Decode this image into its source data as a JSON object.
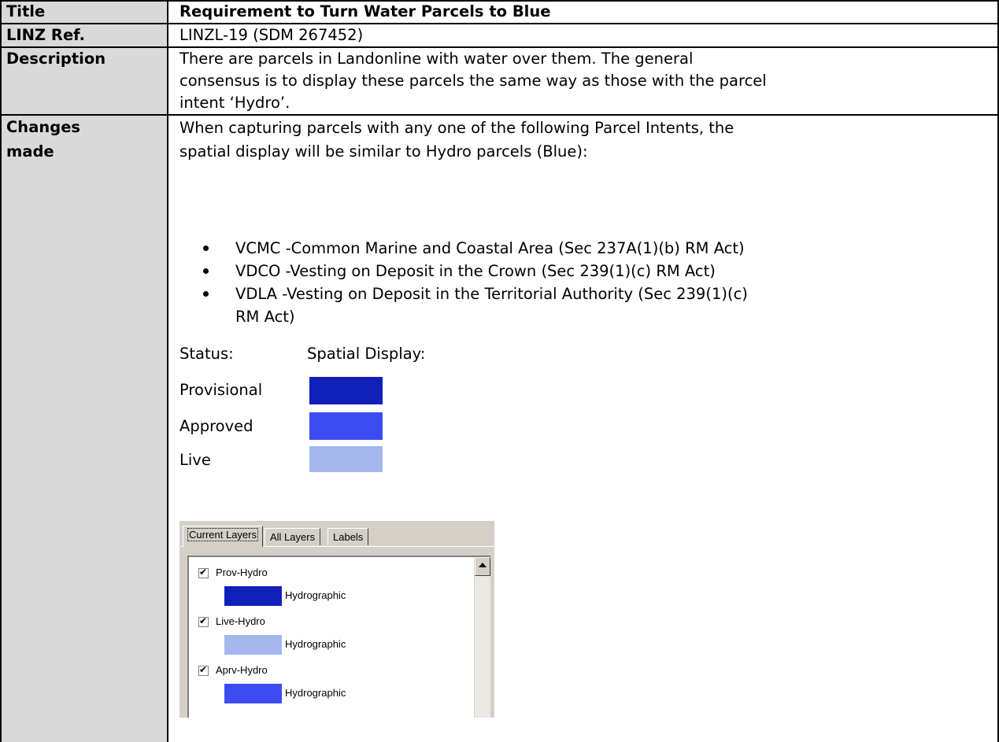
{
  "rows": {
    "title": {
      "label": "Title",
      "value": "Requirement to Turn Water Parcels to Blue"
    },
    "ref": {
      "label": "LINZ Ref.",
      "value": "LINZL-19 (SDM 267452)"
    },
    "description": {
      "label": "Description",
      "lines": [
        "There are parcels in Landonline with water over them. The general",
        "consensus is to display these parcels the same way as those with the parcel",
        "intent ‘Hydro’."
      ]
    },
    "changes": {
      "label_line1": "Changes",
      "label_line2": "made",
      "intro_lines": [
        "When capturing parcels with any one of the following Parcel Intents, the",
        "spatial display will be similar to Hydro parcels (Blue):"
      ],
      "bullets": [
        "VCMC -Common Marine and Coastal Area (Sec 237A(1)(b) RM Act)",
        "VDCO -Vesting on Deposit in the Crown (Sec 239(1)(c) RM Act)",
        "VDLA -Vesting on Deposit in the Territorial Authority (Sec 239(1)(c)",
        "RM Act)"
      ],
      "status_header": "Status:",
      "display_header": "Spatial Display:",
      "legend": [
        {
          "status": "Provisional",
          "color": "#1120b8"
        },
        {
          "status": "Approved",
          "color": "#3d4cf2"
        },
        {
          "status": "Live",
          "color": "#a4b8ee"
        }
      ]
    }
  },
  "layer_panel": {
    "tabs": [
      "Current Layers",
      "All Layers",
      "Labels"
    ],
    "layers": [
      {
        "name": "Prov-Hydro",
        "sub": "Hydrographic",
        "color": "#1120b8",
        "checked": true
      },
      {
        "name": "Live-Hydro",
        "sub": "Hydrographic",
        "color": "#a4b8ee",
        "checked": true
      },
      {
        "name": "Aprv-Hydro",
        "sub": "Hydrographic",
        "color": "#3d4cf2",
        "checked": true
      }
    ]
  }
}
